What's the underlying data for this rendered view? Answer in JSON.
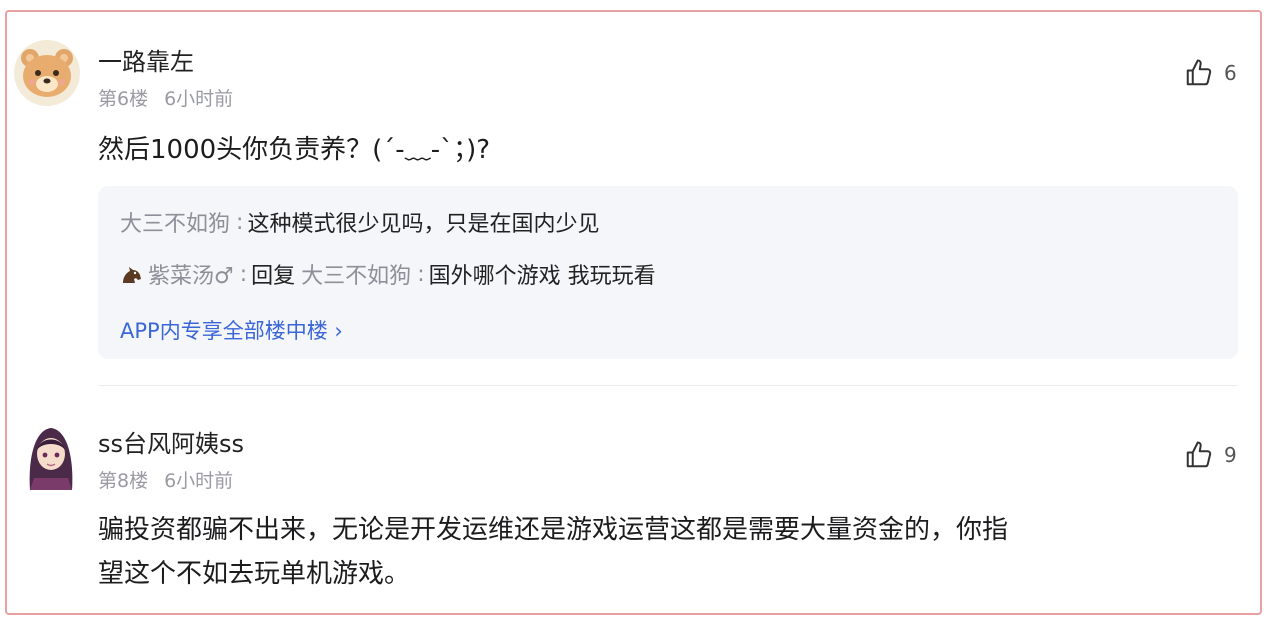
{
  "comments": [
    {
      "username": "一路靠左",
      "floor": "第6楼",
      "time": "6小时前",
      "likes": "6",
      "content": "然后1000头你负责养？(´-﹏-`；)?",
      "replies": [
        {
          "author": "大三不如狗",
          "separator": ":",
          "text": "这种模式很少见吗，只是在国内少见"
        },
        {
          "author": "紫菜汤♂",
          "separator": ":",
          "reply_word": "回复",
          "reply_to": "大三不如狗",
          "separator2": ":",
          "text": "国外哪个游戏 我玩玩看"
        }
      ],
      "more_replies_label": "APP内专享全部楼中楼 ›"
    },
    {
      "username": "ss台风阿姨ss",
      "floor": "第8楼",
      "time": "6小时前",
      "likes": "9",
      "content_lines": [
        "骗投资都骗不出来，无论是开发运维还是游戏运营这都是需要大量资金的，你指",
        "望这个不如去玩单机游戏。"
      ]
    }
  ],
  "colors": {
    "accent_link": "#3a66d8",
    "border": "#e8a0a0",
    "muted": "#9a9aa3"
  },
  "icons": {
    "like": "thumbs-up-icon",
    "avatar1": "bear-avatar",
    "avatar2": "anime-girl-avatar",
    "reply_badge": "horse-icon"
  }
}
